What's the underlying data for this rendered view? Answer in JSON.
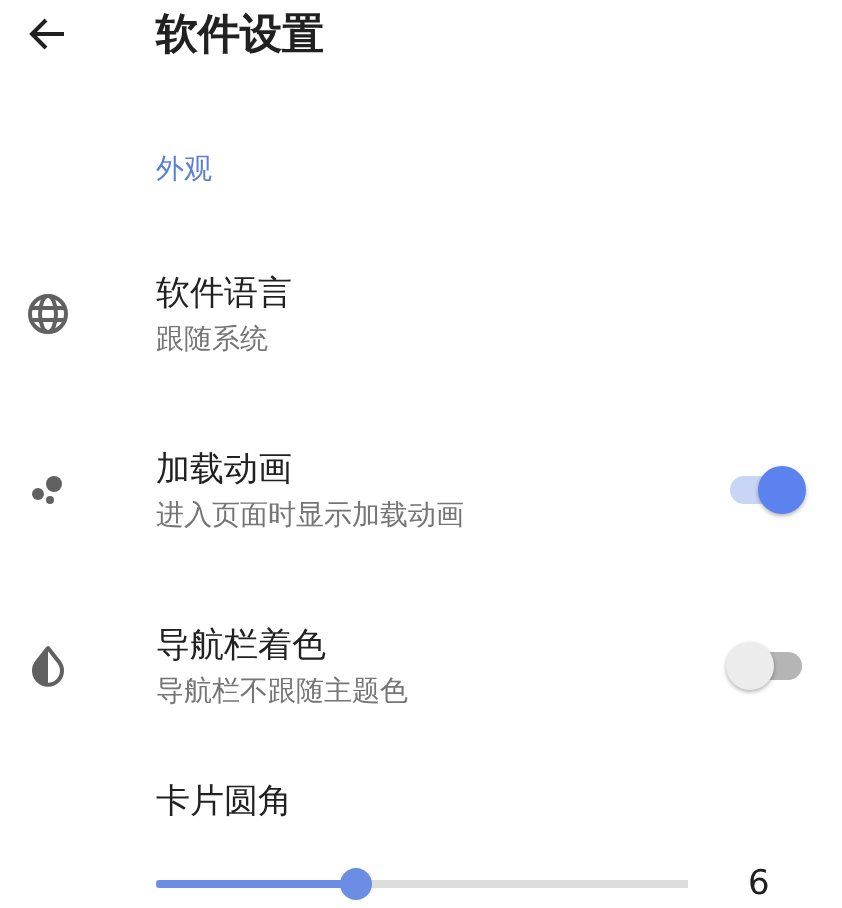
{
  "app_bar": {
    "title": "软件设置"
  },
  "section": {
    "title": "外观"
  },
  "settings": [
    {
      "kind": "nav",
      "title": "软件语言",
      "subtitle": "跟随系统"
    },
    {
      "kind": "toggle",
      "title": "加载动画",
      "subtitle": "进入页面时显示加载动画",
      "on": true
    },
    {
      "kind": "toggle",
      "title": "导航栏着色",
      "subtitle": "导航栏不跟随主题色",
      "on": false
    },
    {
      "kind": "slider",
      "title": "卡片圆角",
      "level": 0.376,
      "reading": "6"
    }
  ]
}
